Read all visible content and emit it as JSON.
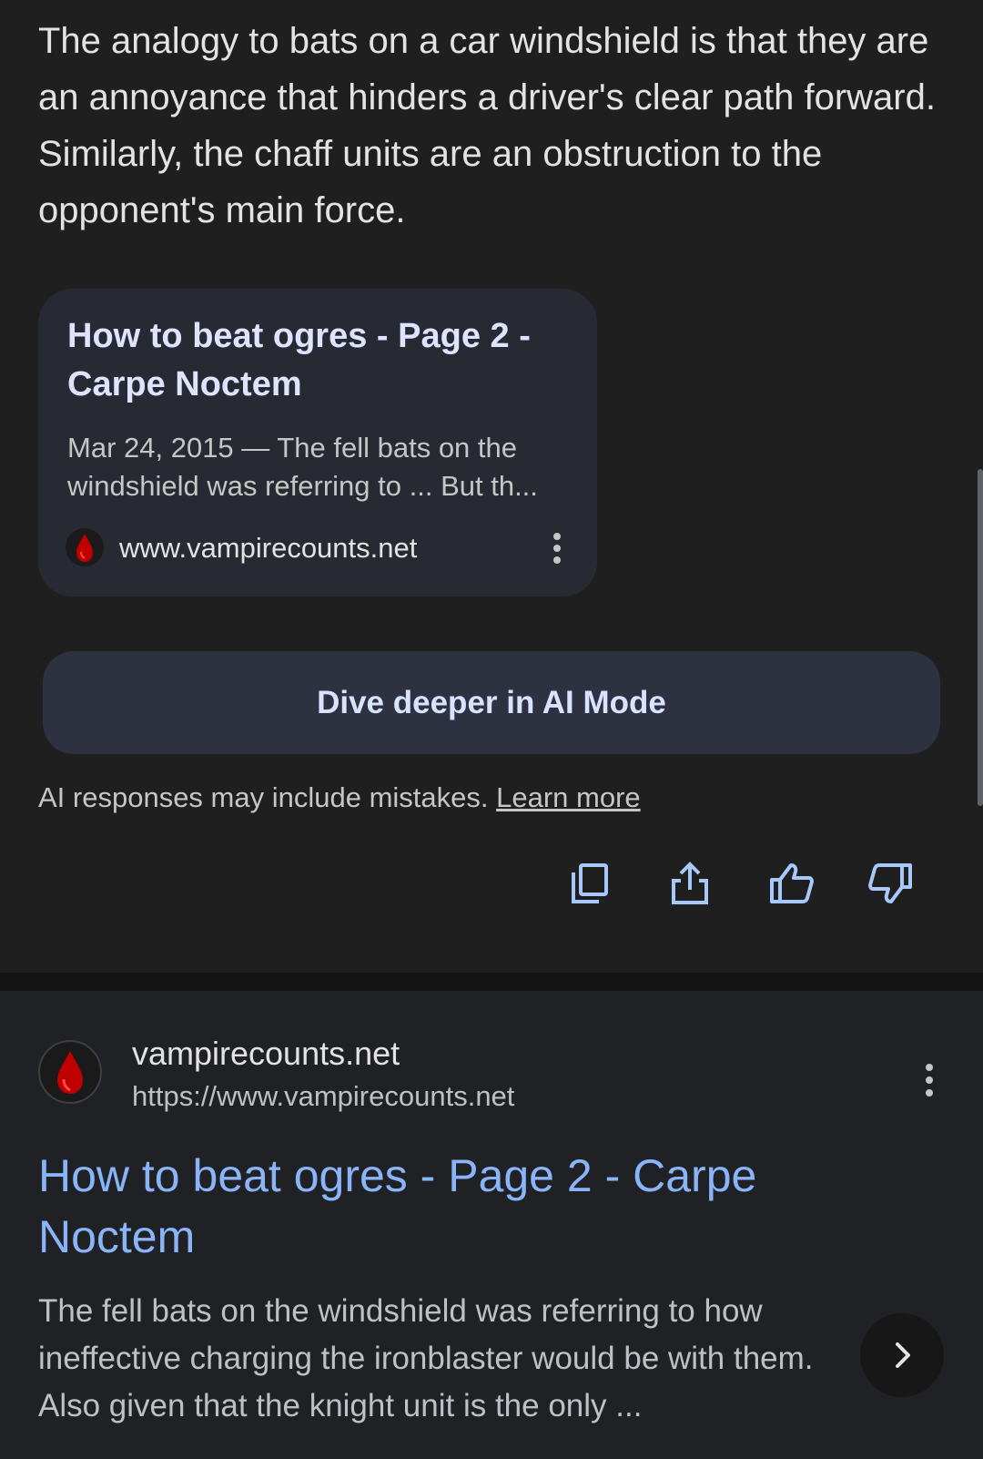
{
  "ai_overview": {
    "paragraph": "The analogy to bats on a car windshield is that they are an annoyance that hinders a driver's clear path forward. Similarly, the chaff units are an obstruction to the opponent's main force.",
    "source_card": {
      "title": "How to beat ogres - Page 2 - Carpe Noctem",
      "snippet": "Mar 24, 2015 — The fell bats on the windshield was referring to ... But th...",
      "site": "www.vampirecounts.net",
      "favicon_icon": "blood-drop-icon",
      "menu_icon": "more-vert-icon"
    },
    "dive_button_label": "Dive deeper in AI Mode",
    "disclaimer_text": "AI responses may include mistakes.",
    "learn_more_label": "Learn more",
    "action_icons": [
      "copy-icon",
      "share-icon",
      "thumbs-up-icon",
      "thumbs-down-icon"
    ]
  },
  "result": {
    "site_name": "vampirecounts.net",
    "url": "https://www.vampirecounts.net",
    "title": "How to beat ogres - Page 2 - Carpe Noctem",
    "snippet": "The fell bats on the windshield was referring to how ineffective charging the ironblaster would be with them. Also given that the knight unit is the only ...",
    "favicon_icon": "blood-drop-icon",
    "menu_icon": "more-vert-icon",
    "expand_icon": "chevron-right-icon"
  },
  "colors": {
    "background": "#1f1f1f",
    "card_background": "#282a33",
    "button_background": "#2d3140",
    "link_blue": "#8ab4f8",
    "icon_blue": "#a8c7fa",
    "favicon_red": "#c00000"
  }
}
